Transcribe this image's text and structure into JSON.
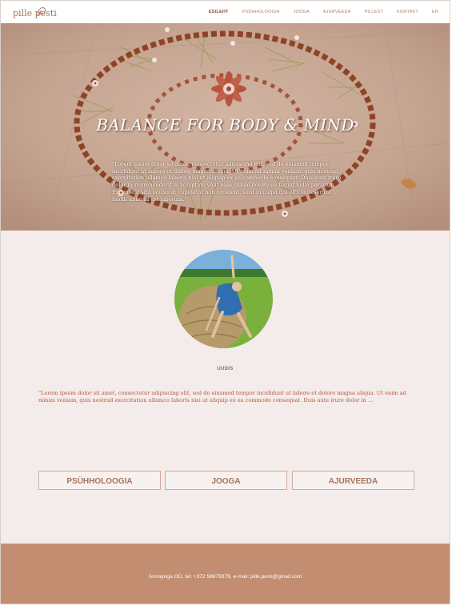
{
  "header": {
    "logo": "pille pesti",
    "nav": [
      {
        "label": "ESILEHT",
        "active": true
      },
      {
        "label": "PSÜHHOLOOGIA",
        "active": false
      },
      {
        "label": "JOOGA",
        "active": false
      },
      {
        "label": "AJURVEEDA",
        "active": false
      },
      {
        "label": "PILLEST",
        "active": false
      },
      {
        "label": "KONTAKT",
        "active": false
      },
      {
        "label": "EN",
        "active": false
      }
    ]
  },
  "hero": {
    "title": "BALANCE FOR BODY & MIND",
    "text": "\"Lorem ipsum dolor sit amet, consectetur adipiscing elit, sed do eiusmod tempor incididunt ut labore et dolore magna aliqua. Ut enim ad minim veniam, quis nostrud exercitation ullamco laboris nisi ut aliquip ex ea commodo consequat. Duis aute irure dolor in reprehenderit in voluptate velit esse cillum dolore eu fugiat nulla pariatur. Excepteur sint occaecat cupidatat non proident, sunt in culpa qui officia deserunt mollit anim id est laborum.\""
  },
  "news": {
    "title": "UUDIS",
    "text": "\"Lorem ipsum dolor sit amet, consectetur adipiscing elit, sed do eiusmod tempor incididunt ut labore et dolore magna aliqua. Ut enim ad minim veniam, quis nostrud exercitation ullamco laboris nisi ut aliquip ex ea commodo consequat. Duis aute irure dolor in ..."
  },
  "cards": [
    "PSÜHHOLOOGIA",
    "JOOGA",
    "AJURVEEDA"
  ],
  "footer": {
    "text": "Amrayoga OÜ, tel: +372 58679379, e-mail: pille.pesti@gmail.com"
  },
  "colors": {
    "accent": "#c28d70",
    "nav_text": "#b07e67",
    "news_text": "#b5563a",
    "background": "#f3ecea"
  }
}
